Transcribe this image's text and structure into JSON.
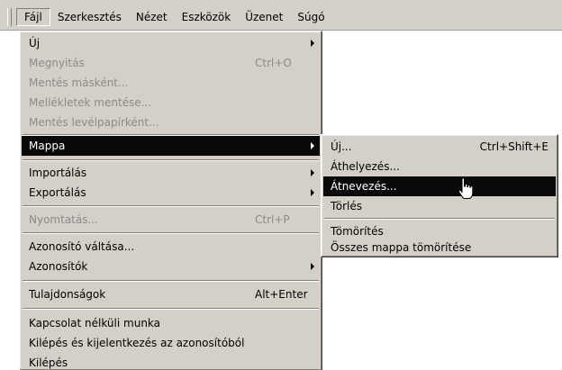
{
  "menubar": {
    "items": [
      "Fájl",
      "Szerkesztés",
      "Nézet",
      "Eszközök",
      "Üzenet",
      "Súgó"
    ]
  },
  "file_menu": {
    "items": [
      {
        "label": "Új",
        "shortcut": "",
        "submenu": true,
        "disabled": false
      },
      {
        "label": "Megnyitás",
        "shortcut": "Ctrl+O",
        "disabled": true
      },
      {
        "label": "Mentés másként...",
        "shortcut": "",
        "disabled": true
      },
      {
        "label": "Mellékletek mentése...",
        "shortcut": "",
        "disabled": true
      },
      {
        "label": "Mentés levélpapírként...",
        "shortcut": "",
        "disabled": true
      },
      {
        "label": "Mappa",
        "shortcut": "",
        "submenu": true,
        "highlighted": true
      },
      {
        "label": "Importálás",
        "submenu": true
      },
      {
        "label": "Exportálás",
        "submenu": true
      },
      {
        "label": "Nyomtatás...",
        "shortcut": "Ctrl+P",
        "disabled": true
      },
      {
        "label": "Azonosító váltása..."
      },
      {
        "label": "Azonosítók",
        "submenu": true
      },
      {
        "label": "Tulajdonságok",
        "shortcut": "Alt+Enter"
      },
      {
        "label": "Kapcsolat nélküli munka"
      },
      {
        "label": "Kilépés és kijelentkezés az azonosítóból"
      },
      {
        "label": "Kilépés"
      }
    ]
  },
  "folder_submenu": {
    "items": [
      {
        "label": "Új...",
        "shortcut": "Ctrl+Shift+E"
      },
      {
        "label": "Áthelyezés..."
      },
      {
        "label": "Átnevezés...",
        "highlighted": true
      },
      {
        "label": "Törlés"
      },
      {
        "label": "Tömörítés"
      },
      {
        "label": "Összes mappa tömörítése"
      }
    ]
  },
  "cursor_icon": "hand-pointer-icon"
}
